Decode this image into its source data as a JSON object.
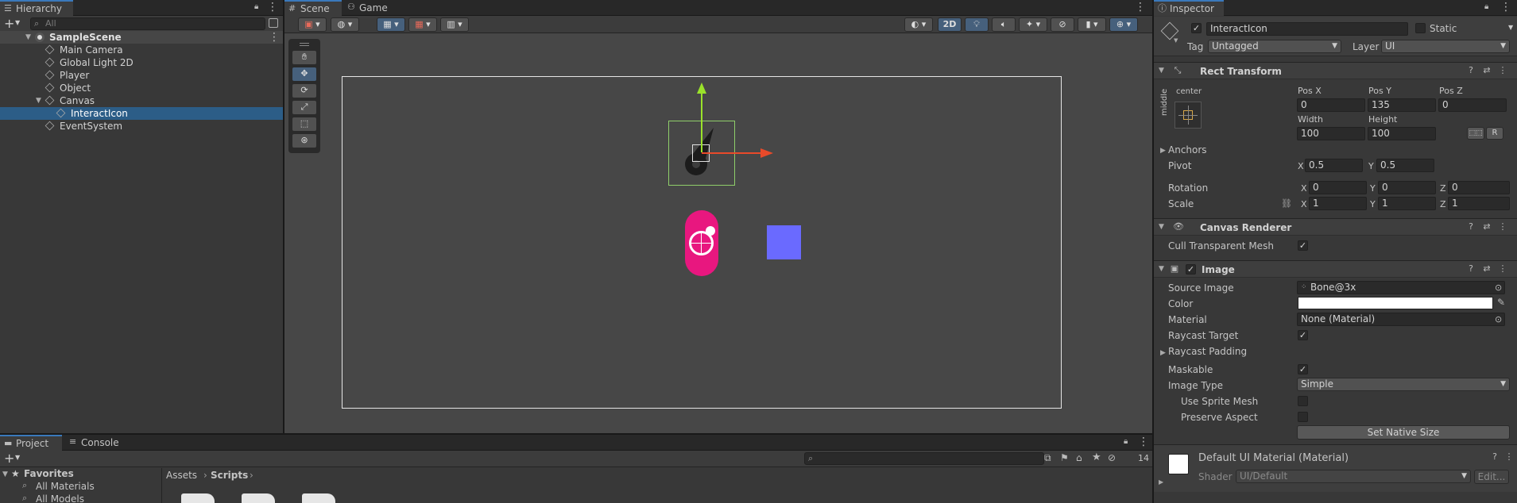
{
  "hierarchy": {
    "tab_label": "Hierarchy",
    "search_placeholder": "All",
    "scene_name": "SampleScene",
    "items": [
      {
        "label": "Main Camera"
      },
      {
        "label": "Global Light 2D"
      },
      {
        "label": "Player"
      },
      {
        "label": "Object"
      },
      {
        "label": "Canvas"
      },
      {
        "label": "InteractIcon"
      },
      {
        "label": "EventSystem"
      }
    ]
  },
  "scene_view": {
    "tabs": [
      {
        "label": "Scene"
      },
      {
        "label": "Game"
      }
    ],
    "mode_2d": "2D",
    "tools": [
      "hand-tool",
      "move-tool",
      "rotate-tool",
      "scale-tool",
      "rect-tool",
      "transform-tool"
    ],
    "colors": {
      "background": "#474747",
      "pink_icon": "#e8177f",
      "blue_square": "#6a6aff",
      "x_axis": "#e94a2a",
      "y_axis": "#9ae22a"
    }
  },
  "inspector": {
    "tab_label": "Inspector",
    "object_name": "InteractIcon",
    "static_label": "Static",
    "tag_label": "Tag",
    "tag_value": "Untagged",
    "layer_label": "Layer",
    "layer_value": "UI",
    "rect_transform": {
      "title": "Rect Transform",
      "anchor_h": "center",
      "anchor_v": "middle",
      "pos_x_label": "Pos X",
      "pos_x": "0",
      "pos_y_label": "Pos Y",
      "pos_y": "135",
      "pos_z_label": "Pos Z",
      "pos_z": "0",
      "width_label": "Width",
      "width": "100",
      "height_label": "Height",
      "height": "100",
      "r_button": "R",
      "anchors_label": "Anchors",
      "pivot_label": "Pivot",
      "pivot_x": "0.5",
      "pivot_y": "0.5",
      "rotation_label": "Rotation",
      "rot_x": "0",
      "rot_y": "0",
      "rot_z": "0",
      "scale_label": "Scale",
      "scale_x": "1",
      "scale_y": "1",
      "scale_z": "1",
      "x": "X",
      "y": "Y",
      "z": "Z"
    },
    "canvas_renderer": {
      "title": "Canvas Renderer",
      "cull_label": "Cull Transparent Mesh"
    },
    "image": {
      "title": "Image",
      "source_image_label": "Source Image",
      "source_image": "Bone@3x",
      "color_label": "Color",
      "material_label": "Material",
      "material": "None (Material)",
      "raycast_target_label": "Raycast Target",
      "raycast_padding_label": "Raycast Padding",
      "maskable_label": "Maskable",
      "image_type_label": "Image Type",
      "image_type": "Simple",
      "use_sprite_mesh_label": "Use Sprite Mesh",
      "preserve_aspect_label": "Preserve Aspect",
      "set_native_size": "Set Native Size"
    },
    "material_section": {
      "title": "Default UI Material (Material)",
      "shader_label": "Shader",
      "shader_value": "UI/Default",
      "edit_button": "Edit..."
    }
  },
  "project": {
    "tabs": [
      {
        "label": "Project"
      },
      {
        "label": "Console"
      }
    ],
    "favorites_label": "Favorites",
    "favorites": [
      {
        "label": "All Materials"
      },
      {
        "label": "All Models"
      }
    ],
    "breadcrumb": [
      {
        "label": "Assets"
      },
      {
        "label": "Scripts"
      }
    ],
    "hidden_count": "14"
  }
}
